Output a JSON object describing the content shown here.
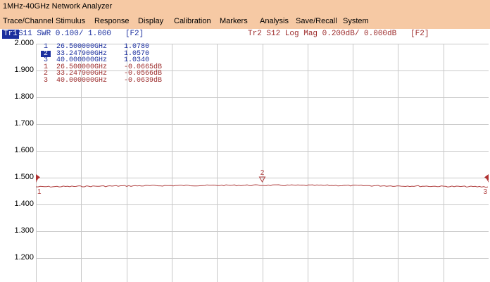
{
  "window": {
    "title": "1MHz-40GHz Network Analyzer"
  },
  "menu": [
    "Trace/Channel",
    "Stimulus",
    "Response",
    "Display",
    "Calibration",
    "Markers",
    "Analysis",
    "Save/Recall",
    "System"
  ],
  "trace1": {
    "label": "Tr1",
    "info": "S11 SWR 0.100/ 1.000",
    "tag": "[F2]",
    "color": "#1b2f9e"
  },
  "trace2": {
    "info": "Tr2 S12 Log Mag 0.200dB/ 0.000dB",
    "tag": "[F2]",
    "color": "#9c2a2a"
  },
  "y_axis": {
    "labels": [
      "2.000",
      "1.900",
      "1.800",
      "1.700",
      "1.600",
      "1.500",
      "1.400",
      "1.300",
      "1.200"
    ]
  },
  "markers_tr1": [
    {
      "num": "1",
      "freq": "26.500000GHz",
      "value": "1.0780",
      "selected": false
    },
    {
      "num": "2",
      "freq": "33.247900GHz",
      "value": "1.0570",
      "selected": true
    },
    {
      "num": "3",
      "freq": "40.000000GHz",
      "value": "1.0340",
      "selected": false
    }
  ],
  "markers_tr2": [
    {
      "num": "1",
      "freq": "26.500000GHz",
      "value": "-0.0665dB"
    },
    {
      "num": "2",
      "freq": "33.247900GHz",
      "value": "-0.0566dB"
    },
    {
      "num": "3",
      "freq": "40.000000GHz",
      "value": "-0.0639dB"
    }
  ],
  "plot_markers": [
    {
      "num": "1",
      "pos": 0.0
    },
    {
      "num": "2",
      "pos": 0.5
    },
    {
      "num": "3",
      "pos": 1.0
    }
  ],
  "colors": {
    "grid": "#c8c8c8",
    "trace": "#b04040",
    "title_bg": "#f6c9a4"
  }
}
